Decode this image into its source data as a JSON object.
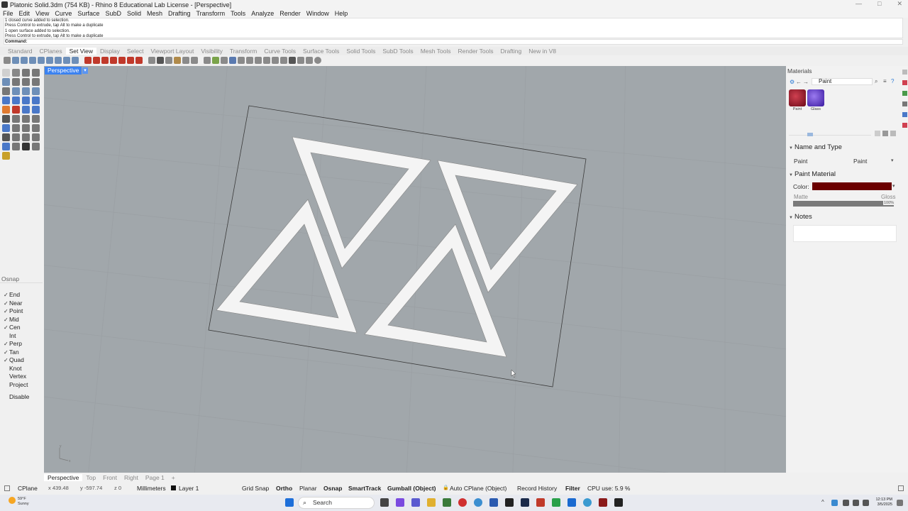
{
  "window": {
    "title": "Platonic Solid.3dm (754 KB) - Rhino 8 Educational Lab License - [Perspective]",
    "controls": [
      "—",
      "□",
      "✕"
    ]
  },
  "menu": [
    "File",
    "Edit",
    "View",
    "Curve",
    "Surface",
    "SubD",
    "Solid",
    "Mesh",
    "Drafting",
    "Transform",
    "Tools",
    "Analyze",
    "Render",
    "Window",
    "Help"
  ],
  "command_history": [
    "1 closed curve added to selection.",
    "Press Control to extrude, tap Alt to make a duplicate",
    "1 open surface added to selection.",
    "Press Control to extrude, tap Alt to make a duplicate"
  ],
  "command_prompt": "Command:",
  "toolbar_tabs": [
    "Standard",
    "CPlanes",
    "Set View",
    "Display",
    "Select",
    "Viewport Layout",
    "Visibility",
    "Transform",
    "Curve Tools",
    "Surface Tools",
    "Solid Tools",
    "SubD Tools",
    "Mesh Tools",
    "Render Tools",
    "Drafting",
    "New in V8"
  ],
  "active_toolbar_tab": "Set View",
  "viewport": {
    "label": "Perspective",
    "tabs": [
      "Perspective",
      "Top",
      "Front",
      "Right",
      "Page 1"
    ],
    "add_tab": "+",
    "axis_x": "x",
    "axis_y": "y"
  },
  "osnap": {
    "title": "Osnap",
    "items": [
      {
        "label": "End",
        "checked": true
      },
      {
        "label": "Near",
        "checked": true
      },
      {
        "label": "Point",
        "checked": true
      },
      {
        "label": "Mid",
        "checked": true
      },
      {
        "label": "Cen",
        "checked": true
      },
      {
        "label": "Int",
        "checked": false
      },
      {
        "label": "Perp",
        "checked": true
      },
      {
        "label": "Tan",
        "checked": true
      },
      {
        "label": "Quad",
        "checked": true
      },
      {
        "label": "Knot",
        "checked": false
      },
      {
        "label": "Vertex",
        "checked": false
      },
      {
        "label": "Project",
        "checked": false
      }
    ],
    "disable": "Disable"
  },
  "materials": {
    "panel_title": "Materials",
    "search_value": "Paint",
    "thumbs": [
      {
        "label": "Paint",
        "color": "#8b1a2b"
      },
      {
        "label": "Glass",
        "color": "#6a3bd6"
      }
    ],
    "name_and_type": "Name and Type",
    "name_value": "Paint",
    "type_value": "Paint",
    "paint_material": "Paint Material",
    "color_label": "Color:",
    "color_value": "#6b0000",
    "matte_label": "Matte",
    "gloss_label": "Gloss",
    "gloss_pct": "100%",
    "notes": "Notes"
  },
  "status": {
    "cplane": "CPlane",
    "x": "x 439.48",
    "y": "y -597.74",
    "z": "z 0",
    "units": "Millimeters",
    "layer": "Layer 1",
    "grid_snap": "Grid Snap",
    "ortho": "Ortho",
    "planar": "Planar",
    "osnap": "Osnap",
    "smarttrack": "SmartTrack",
    "gumball": "Gumball (Object)",
    "auto_cplane": "Auto CPlane (Object)",
    "record_history": "Record History",
    "filter": "Filter",
    "cpu": "CPU use: 5.9 %"
  },
  "taskbar": {
    "search": "Search",
    "weather_temp": "59°F",
    "weather_desc": "Sunny",
    "time": "12:13 PM",
    "date": "3/5/2025"
  }
}
